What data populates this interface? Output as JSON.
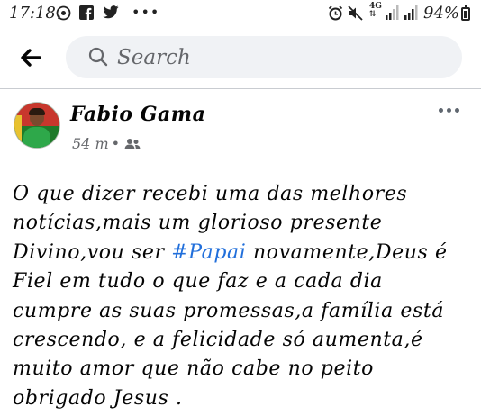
{
  "status_bar": {
    "time": "17:18",
    "left_icons": [
      "whatsapp-icon",
      "facebook-icon",
      "twitter-icon",
      "more-notifications-icon"
    ],
    "right_icons": [
      "alarm-icon",
      "mute-icon",
      "network-4g-icon",
      "signal-icon",
      "signal-icon"
    ],
    "network": "4G",
    "battery": "94%",
    "battery_level": 0.94
  },
  "header": {
    "back_icon": "back-arrow-icon",
    "search_placeholder": "Search"
  },
  "post": {
    "author": "Fabio Gama",
    "time": "54 m",
    "separator": "•",
    "audience_icon": "friends-icon",
    "lines": [
      "O que dizer recebi uma das melhores",
      "notícias,mais um glorioso presente",
      "Divino,vou ser",
      "Fiel em tudo o que faz e a cada dia",
      "cumpre as suas promessas,a família está",
      "crescendo, e a felicidade só aumenta,é",
      "muito amor que não cabe no peito",
      "obrigado Jesus ."
    ],
    "hashtag": "#Papai",
    "line3_rest": " novamente,Deus é",
    "colors": {
      "hashtag": "#216fdb",
      "meta": "#65676b"
    }
  }
}
